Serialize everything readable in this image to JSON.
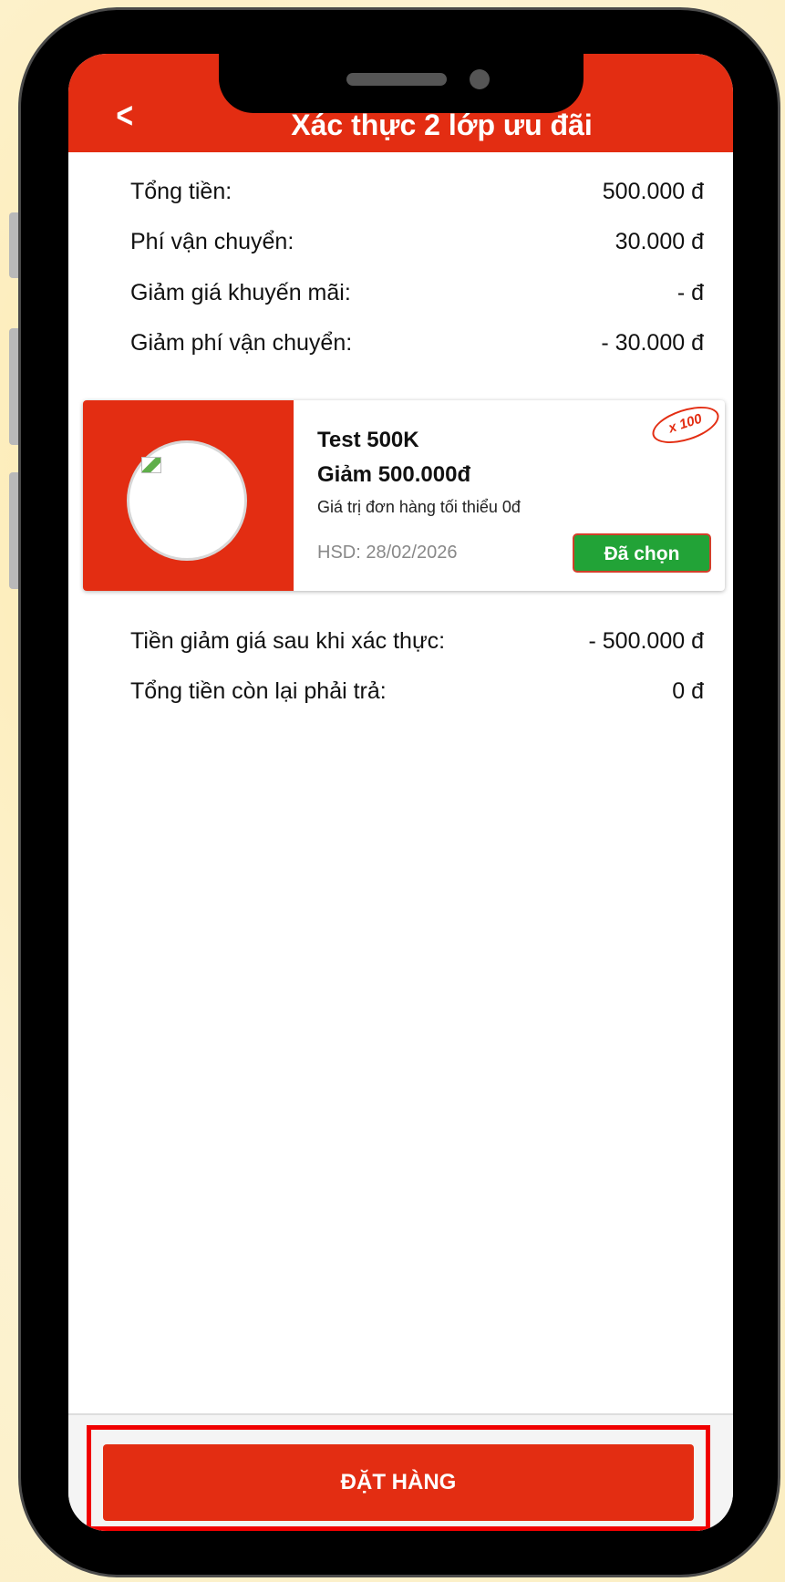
{
  "header": {
    "back_icon": "chevron-left-icon",
    "title": "Xác thực 2 lớp ưu đãi"
  },
  "summary": [
    {
      "label": "Tổng tiền:",
      "value": "500.000 đ"
    },
    {
      "label": "Phí vận chuyển:",
      "value": "30.000 đ"
    },
    {
      "label": "Giảm giá khuyến mãi:",
      "value": "- đ"
    },
    {
      "label": "Giảm phí vận chuyển:",
      "value": "- 30.000 đ"
    }
  ],
  "voucher": {
    "name": "Test 500K",
    "discount": "Giảm 500.000đ",
    "min_order": "Giá trị đơn hàng tối thiểu 0đ",
    "expiry": "HSD: 28/02/2026",
    "button_label": "Đã chọn",
    "quantity_badge": "x 100"
  },
  "totals": [
    {
      "label": "Tiền giảm giá sau khi xác thực:",
      "value": "- 500.000 đ"
    },
    {
      "label": "Tổng tiền còn lại phải trả:",
      "value": "0 đ"
    }
  ],
  "footer": {
    "order_label": "ĐẶT HÀNG"
  },
  "colors": {
    "brand_red": "#e32d12",
    "selected_green": "#22a337",
    "highlight": "#f00000"
  }
}
